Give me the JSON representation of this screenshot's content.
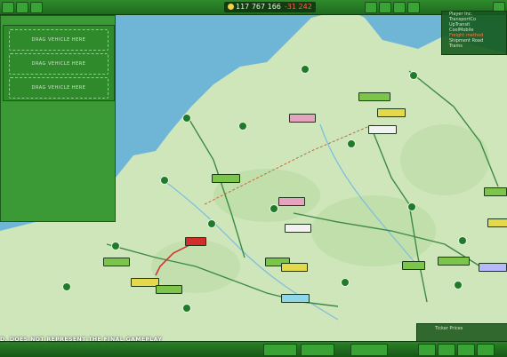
{
  "topbar": {
    "money": "117 767 166",
    "delta": "-31 242"
  },
  "left_panel": {
    "slot1_label": "DRAG VEHICLE HERE",
    "slot2_label": "DRAG VEHICLE HERE",
    "slot3_label": "DRAG VEHICLE HERE"
  },
  "right_list": {
    "items": [
      "Player Inc.",
      "TransportCo",
      "UpTransit",
      "CoolMobile",
      "Freight method",
      "Shipment Road",
      "Trams"
    ]
  },
  "ticker": {
    "label": "Ticker Prices"
  },
  "bottom": {
    "caption": "D. DOES NOT REPRESENT THE FINAL GAMEPLAY"
  },
  "colors": {
    "land": "#cfe6bb",
    "water": "#6fb6d6",
    "ui_green": "#2f8a2b",
    "negative": "#ff5a4a"
  }
}
